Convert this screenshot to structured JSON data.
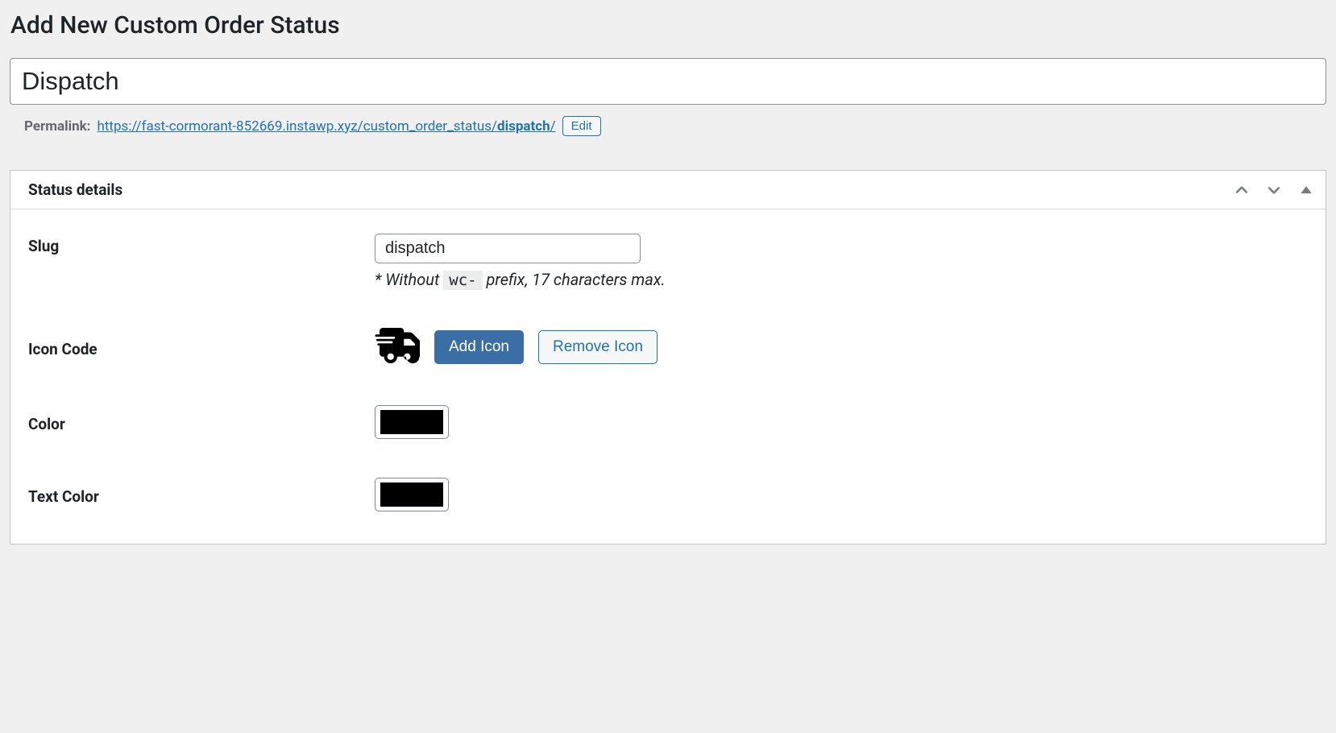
{
  "page": {
    "title": "Add New Custom Order Status"
  },
  "post_title": {
    "value": "Dispatch"
  },
  "permalink": {
    "label": "Permalink:",
    "url_base": "https://fast-cormorant-852669.instawp.xyz/custom_order_status/",
    "slug": "dispatch",
    "trail": "/",
    "edit_label": "Edit"
  },
  "metabox": {
    "title": "Status details"
  },
  "fields": {
    "slug": {
      "label": "Slug",
      "value": "dispatch",
      "hint_prefix": "* Without ",
      "hint_code": "wc-",
      "hint_suffix": " prefix, 17 characters max."
    },
    "icon_code": {
      "label": "Icon Code",
      "add_label": "Add Icon",
      "remove_label": "Remove Icon",
      "icon_name": "truck-fast-icon"
    },
    "color": {
      "label": "Color",
      "value": "#000000"
    },
    "text_color": {
      "label": "Text Color",
      "value": "#000000"
    }
  }
}
